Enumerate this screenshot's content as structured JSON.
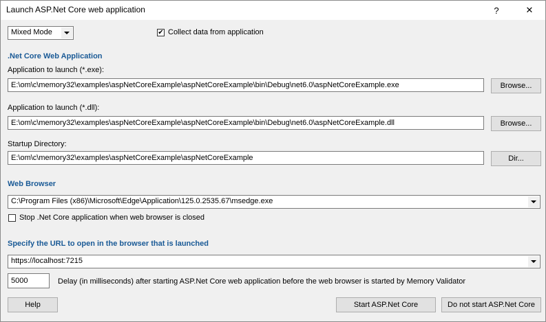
{
  "window": {
    "title": "Launch ASP.Net Core web application",
    "help_glyph": "?",
    "close_glyph": "✕"
  },
  "mode": {
    "selected": "Mixed Mode"
  },
  "collect": {
    "label": "Collect data from application",
    "checked": true,
    "mark": "✔"
  },
  "core_app": {
    "heading": ".Net Core Web Application",
    "exe_label": "Application to launch (*.exe):",
    "exe_value": "E:\\om\\c\\memory32\\examples\\aspNetCoreExample\\aspNetCoreExample\\bin\\Debug\\net6.0\\aspNetCoreExample.exe",
    "exe_browse": "Browse...",
    "dll_label": "Application to launch (*.dll):",
    "dll_value": "E:\\om\\c\\memory32\\examples\\aspNetCoreExample\\aspNetCoreExample\\bin\\Debug\\net6.0\\aspNetCoreExample.dll",
    "dll_browse": "Browse...",
    "dir_label": "Startup Directory:",
    "dir_value": "E:\\om\\c\\memory32\\examples\\aspNetCoreExample\\aspNetCoreExample",
    "dir_button": "Dir..."
  },
  "browser": {
    "heading": "Web Browser",
    "path": "C:\\Program Files (x86)\\Microsoft\\Edge\\Application\\125.0.2535.67\\msedge.exe",
    "stop_label": "Stop .Net Core application when web browser is closed",
    "stop_checked": false
  },
  "url": {
    "heading": "Specify the URL to open in the browser that is launched",
    "value": "https://localhost:7215"
  },
  "delay": {
    "value": "5000",
    "label": "Delay (in milliseconds) after starting ASP.Net Core web application before the web browser is started by Memory Validator"
  },
  "buttons": {
    "help": "Help",
    "start": "Start ASP.Net Core",
    "no_start": "Do not start ASP.Net Core"
  }
}
